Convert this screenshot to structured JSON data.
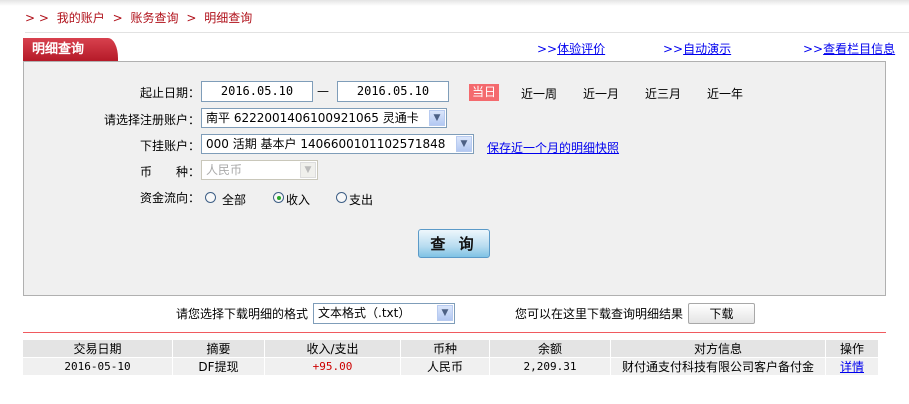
{
  "breadcrumb": {
    "prefix": "> >",
    "items": [
      "我的账户",
      "账务查询",
      "明细查询"
    ],
    "separator": ">"
  },
  "tab_title": "明细查询",
  "top_links": {
    "prefix": ">>",
    "items": [
      "体验评价",
      "自动演示",
      "查看栏目信息"
    ]
  },
  "form": {
    "date_label": "起止日期：",
    "start_date": "2016.05.10",
    "dash": "—",
    "end_date": "2016.05.10",
    "quick_ranges": [
      "当日",
      "近一周",
      "近一月",
      "近三月",
      "近一年"
    ],
    "active_range": "当日",
    "account_label": "请选择注册账户：",
    "account_value": "南平 6222001406100921065 灵通卡",
    "sub_account_label": "下挂账户：",
    "sub_account_value": "000 活期 基本户 1406600101102571848",
    "snapshot_link": "保存近一个月的明细快照",
    "currency_label_1": "币",
    "currency_label_2": "种：",
    "currency_value": "人民币",
    "flow_label": "资金流向：",
    "flow_options": [
      "全部",
      "收入",
      "支出"
    ],
    "flow_selected": "收入",
    "query_button": "查 询"
  },
  "download": {
    "format_label": "请您选择下载明细的格式",
    "format_value": "文本格式（.txt）",
    "hint": "您可以在这里下载查询明细结果",
    "button": "下载"
  },
  "table": {
    "headers": [
      "交易日期",
      "摘要",
      "收入/支出",
      "币种",
      "余额",
      "对方信息",
      "操作"
    ],
    "rows": [
      [
        "2016-05-10",
        "DF提现",
        "+95.00",
        "人民币",
        "2,209.31",
        "财付通支付科技有限公司客户备付金",
        "详情"
      ]
    ]
  },
  "colors": {
    "brand_red": "#b51a28",
    "today_bg": "#f46a6e",
    "amount_red": "#cc0000",
    "link": "#0000ee"
  }
}
